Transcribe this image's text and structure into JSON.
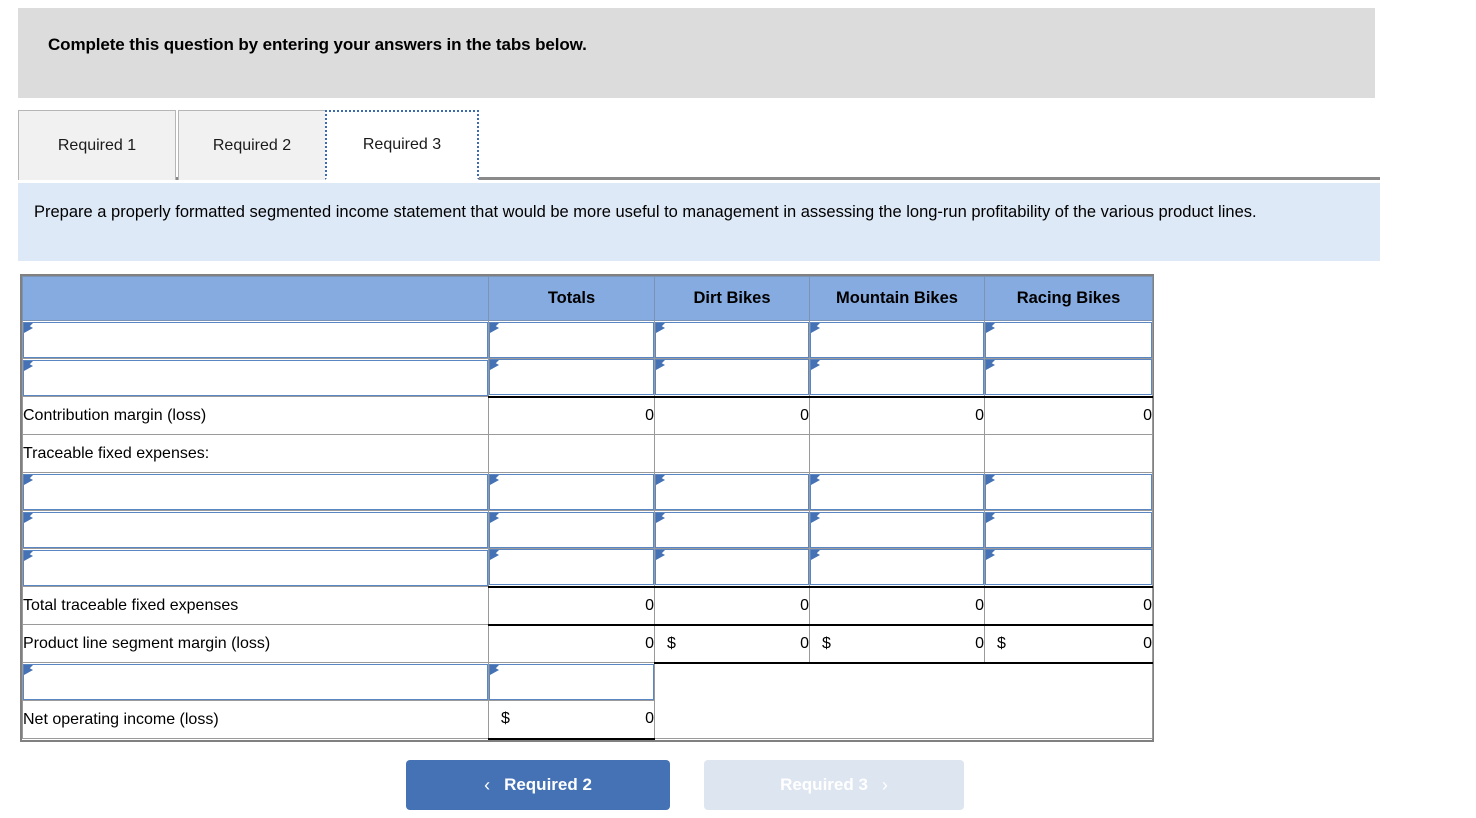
{
  "header": {
    "instruction": "Complete this question by entering your answers in the tabs below."
  },
  "tabs": [
    {
      "label": "Required 1",
      "active": false
    },
    {
      "label": "Required 2",
      "active": false
    },
    {
      "label": "Required 3",
      "active": true
    }
  ],
  "banner": {
    "text": "Prepare a properly formatted segmented income statement that would be more useful to management in assessing the long-run profitability of the various product lines."
  },
  "worksheet": {
    "columns": [
      "",
      "Totals",
      "Dirt Bikes",
      "Mountain Bikes",
      "Racing Bikes"
    ],
    "rows": [
      {
        "type": "input",
        "label": "",
        "totals": "",
        "dirt": "",
        "mountain": "",
        "racing": ""
      },
      {
        "type": "input",
        "label": "",
        "totals": "",
        "dirt": "",
        "mountain": "",
        "racing": ""
      },
      {
        "type": "total",
        "label": "Contribution margin (loss)",
        "totals": "0",
        "dirt": "0",
        "mountain": "0",
        "racing": "0",
        "rule": "top",
        "currency": false
      },
      {
        "type": "static",
        "label": "Traceable fixed expenses:",
        "totals": "",
        "dirt": "",
        "mountain": "",
        "racing": ""
      },
      {
        "type": "input",
        "label": "",
        "totals": "",
        "dirt": "",
        "mountain": "",
        "racing": ""
      },
      {
        "type": "input",
        "label": "",
        "totals": "",
        "dirt": "",
        "mountain": "",
        "racing": ""
      },
      {
        "type": "input",
        "label": "",
        "totals": "",
        "dirt": "",
        "mountain": "",
        "racing": ""
      },
      {
        "type": "total",
        "label": "Total traceable fixed expenses",
        "totals": "0",
        "dirt": "0",
        "mountain": "0",
        "racing": "0",
        "rule": "top",
        "currency": false
      },
      {
        "type": "total",
        "label": "Product line segment margin (loss)",
        "totals": "0",
        "dirt": "0",
        "mountain": "0",
        "racing": "0",
        "rule": "top-bottom-seg",
        "currency": "segments"
      },
      {
        "type": "input-totals-only",
        "label": "",
        "totals": ""
      },
      {
        "type": "grand",
        "label": "Net operating income (loss)",
        "totals": "0",
        "rule": "bottom",
        "currency": true
      }
    ],
    "currency_symbol": "$"
  },
  "footer": {
    "prev_label": "Required 2",
    "next_label": "Required 3",
    "prev_chevron": "‹",
    "next_chevron": "›"
  },
  "colors": {
    "accent_blue": "#4472b4",
    "header_blue": "#85abe0",
    "banner_blue": "#dee9f7",
    "topbar_gray": "#dcdcdc",
    "next_disabled": "#dde5f0"
  }
}
